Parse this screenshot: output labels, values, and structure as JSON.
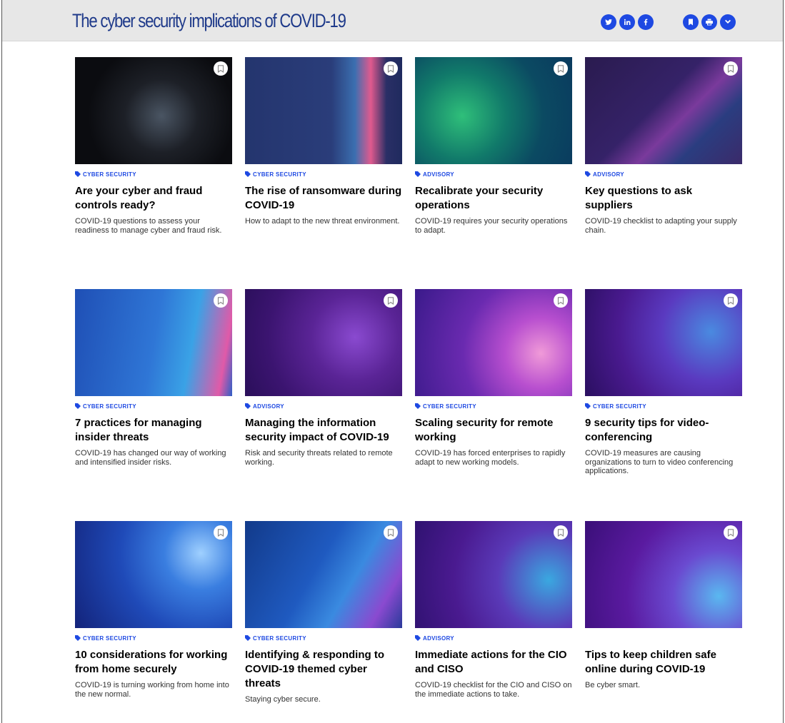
{
  "header": {
    "title": "The cyber security implications of COVID-19",
    "social_icons": [
      "twitter-icon",
      "linkedin-icon",
      "facebook-icon"
    ],
    "tool_icons": [
      "bookmark-icon",
      "print-icon",
      "chevron-down-icon"
    ]
  },
  "colors": {
    "accent": "#1e49e2",
    "title": "#1f3a8a",
    "header_bg": "#e7e7e7"
  },
  "cards": [
    {
      "tag": "CYBER SECURITY",
      "title": "Are your cyber and fraud controls ready?",
      "desc": "COVID-19 questions to assess your readiness to manage cyber and fraud risk.",
      "image": "person-at-computer-photo"
    },
    {
      "tag": "CYBER SECURITY",
      "title": "The rise of ransomware during COVID-19",
      "desc": "How to adapt to the new threat environment.",
      "image": "blue-light-streaks"
    },
    {
      "tag": "ADVISORY",
      "title": "Recalibrate your security operations",
      "desc": "COVID-19 requires your security operations to adapt.",
      "image": "green-fiber-optics"
    },
    {
      "tag": "ADVISORY",
      "title": "Key questions to ask suppliers",
      "desc": "COVID-19 checklist to adapting your supply chain.",
      "image": "purple-light-beams"
    },
    {
      "tag": "CYBER SECURITY",
      "title": "7 practices for managing insider threats",
      "desc": "COVID-19 has changed our way of working and intensified insider risks.",
      "image": "blue-pink-blur"
    },
    {
      "tag": "ADVISORY",
      "title": "Managing the information security impact of COVID-19",
      "desc": "Risk and security threats related to remote working.",
      "image": "purple-network-sphere"
    },
    {
      "tag": "CYBER SECURITY",
      "title": "Scaling security for remote working",
      "desc": "COVID-19 has forced enterprises to rapidly adapt to new working models.",
      "image": "pink-light-waves"
    },
    {
      "tag": "CYBER SECURITY",
      "title": "9 security tips for video-conferencing",
      "desc": "COVID-19 measures are causing organizations to turn to video conferencing applications.",
      "image": "purple-blue-particles"
    },
    {
      "tag": "CYBER SECURITY",
      "title": "10 considerations for working from home securely",
      "desc": "COVID-19 is turning working from home into the new normal.",
      "image": "blue-light-fibers"
    },
    {
      "tag": "CYBER SECURITY",
      "title": "Identifying & responding to COVID-19 themed cyber threats",
      "desc": "Staying cyber secure.",
      "image": "blue-fiber-streams"
    },
    {
      "tag": "ADVISORY",
      "title": "Immediate actions for the CIO and CISO",
      "desc": "COVID-19 checklist for the CIO and CISO on the immediate actions to take.",
      "image": "purple-light-arcs"
    },
    {
      "tag": "",
      "title": "Tips to keep children safe online during COVID-19",
      "desc": "Be cyber smart.",
      "image": "purple-dot-wave"
    }
  ]
}
